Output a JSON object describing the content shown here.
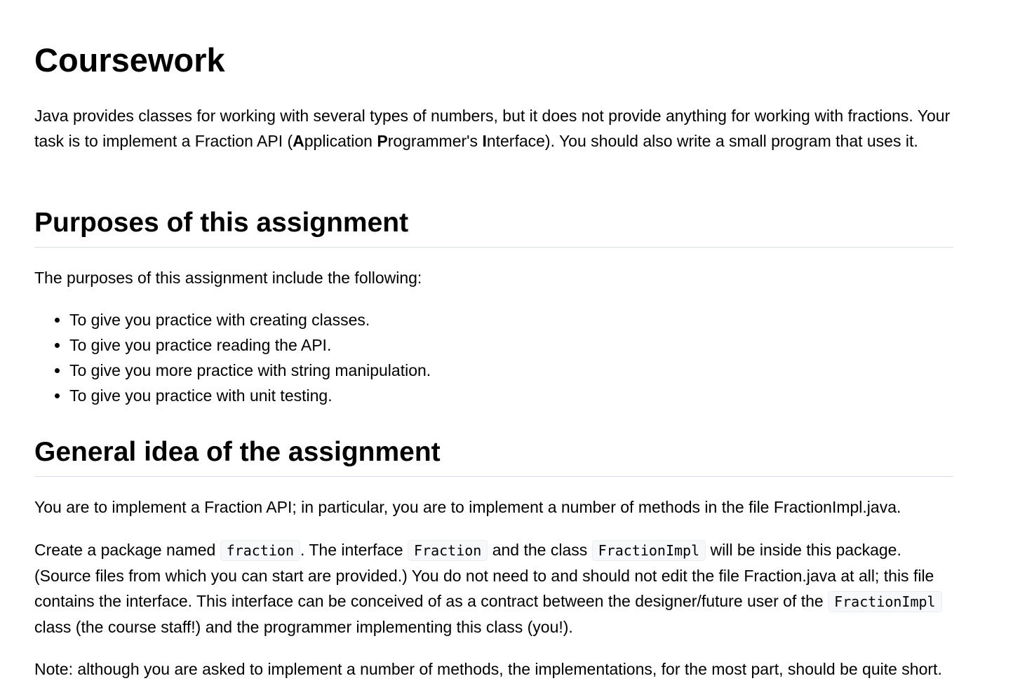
{
  "title": "Coursework",
  "intro": {
    "part1": "Java provides classes for working with several types of numbers, but it does not provide anything for working with fractions. Your task is to implement a Fraction API (",
    "a_bold": "A",
    "a_rest": "pplication ",
    "p_bold": "P",
    "p_rest": "rogrammer's ",
    "i_bold": "I",
    "i_rest": "nterface). You should also write a small program that uses it."
  },
  "purposes": {
    "heading": "Purposes of this assignment",
    "intro": "The purposes of this assignment include the following:",
    "items": [
      "To give you practice with creating classes.",
      "To give you practice reading the API.",
      "To give you more practice with string manipulation.",
      "To give you practice with unit testing."
    ]
  },
  "general": {
    "heading": "General idea of the assignment",
    "p1": "You are to implement a Fraction API; in particular, you are to implement a number of methods in the file FractionImpl.java.",
    "p2": {
      "t1": "Create a package named ",
      "code1": "fraction",
      "t2": ". The interface ",
      "code2": "Fraction",
      "t3": " and the class ",
      "code3": "FractionImpl",
      "t4": " will be inside this package. (Source files from which you can start are provided.) You do not need to and should not edit the file Fraction.java at all; this file contains the interface. This interface can be conceived of as a contract between the designer/future user of the ",
      "code4": "FractionImpl",
      "t5": " class (the course staff!) and the programmer implementing this class (you!)."
    },
    "p3": "Note: although you are asked to implement a number of methods, the implementations, for the most part, should be quite short."
  }
}
